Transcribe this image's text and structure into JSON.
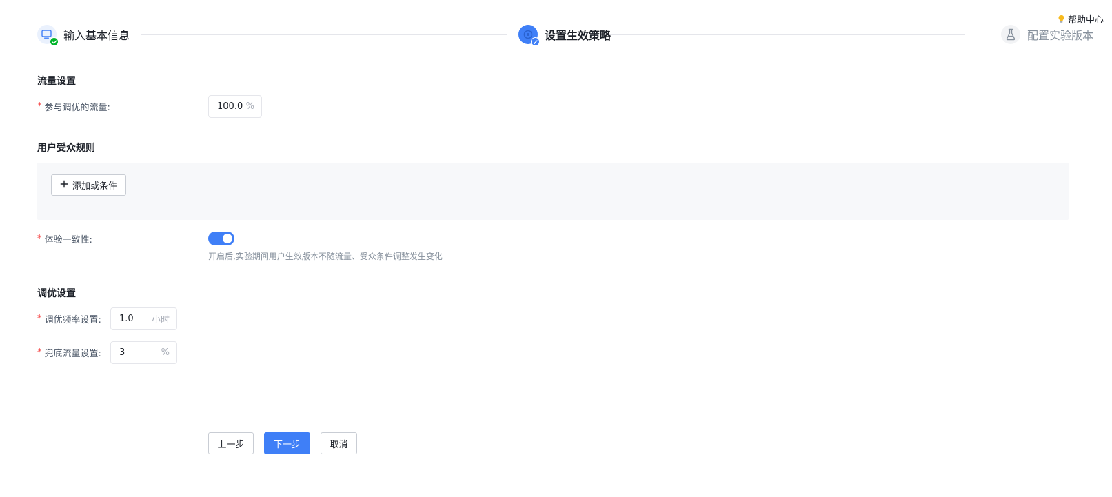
{
  "help": {
    "label": "帮助中心"
  },
  "steps": [
    {
      "label": "输入基本信息",
      "status": "done"
    },
    {
      "label": "设置生效策略",
      "status": "active"
    },
    {
      "label": "配置实验版本",
      "status": "pending"
    }
  ],
  "traffic": {
    "section_title": "流量设置",
    "label": "参与调优的流量:",
    "value": "100.0",
    "unit": "%"
  },
  "audience": {
    "section_title": "用户受众规则",
    "add_button": "添加或条件"
  },
  "consistency": {
    "label": "体验一致性:",
    "enabled": true,
    "hint": "开启后,实验期间用户生效版本不随流量、受众条件调整发生变化"
  },
  "tuning": {
    "section_title": "调优设置",
    "frequency": {
      "label": "调优频率设置:",
      "value": "1.0",
      "unit": "小时"
    },
    "fallback": {
      "label": "兜底流量设置:",
      "value": "3",
      "unit": "%"
    }
  },
  "actions": {
    "prev": "上一步",
    "next": "下一步",
    "cancel": "取消"
  },
  "colors": {
    "primary": "#3f7ff7",
    "required": "#f53f3f",
    "success": "#00b42a"
  }
}
